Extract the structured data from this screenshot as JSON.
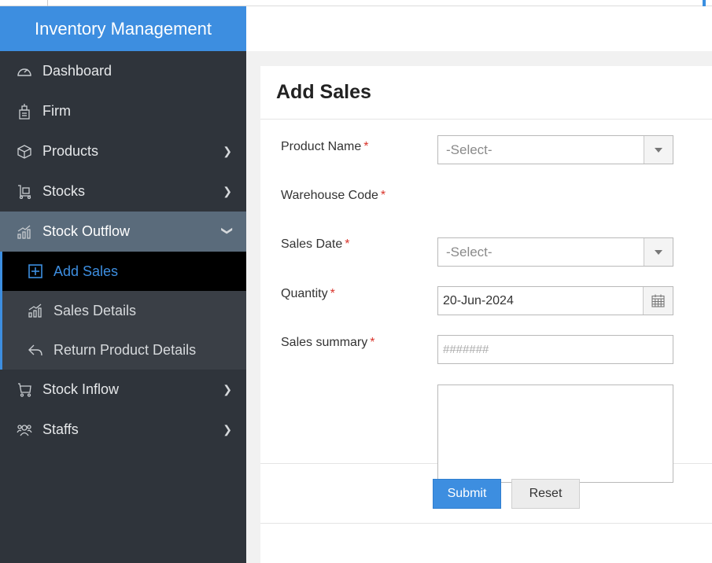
{
  "app": {
    "title": "Inventory Management"
  },
  "sidebar": {
    "items": [
      {
        "label": "Dashboard",
        "icon": "dashboard-icon"
      },
      {
        "label": "Firm",
        "icon": "building-icon"
      },
      {
        "label": "Products",
        "icon": "box-icon"
      },
      {
        "label": "Stocks",
        "icon": "trolley-icon"
      },
      {
        "label": "Stock Outflow",
        "icon": "chart-up-icon"
      },
      {
        "label": "Stock Inflow",
        "icon": "cart-icon"
      },
      {
        "label": "Staffs",
        "icon": "people-icon"
      }
    ],
    "submenu": [
      {
        "label": "Add Sales",
        "icon": "plus-square-icon"
      },
      {
        "label": "Sales Details",
        "icon": "chart-up-icon"
      },
      {
        "label": "Return Product Details",
        "icon": "reply-icon"
      }
    ]
  },
  "page": {
    "title": "Add Sales"
  },
  "form": {
    "product_name_label": "Product Name",
    "product_name_value": "-Select-",
    "warehouse_code_label": "Warehouse Code",
    "warehouse_code_value": "-Select-",
    "sales_date_label": "Sales Date",
    "sales_date_value": "20-Jun-2024",
    "quantity_label": "Quantity",
    "quantity_placeholder": "#######",
    "sales_summary_label": "Sales summary",
    "required_mark": "*"
  },
  "buttons": {
    "submit": "Submit",
    "reset": "Reset"
  },
  "colors": {
    "accent": "#3d8ee0",
    "sidebar": "#2f343b",
    "active_parent": "#5a6b7b",
    "required": "#d9342b"
  }
}
